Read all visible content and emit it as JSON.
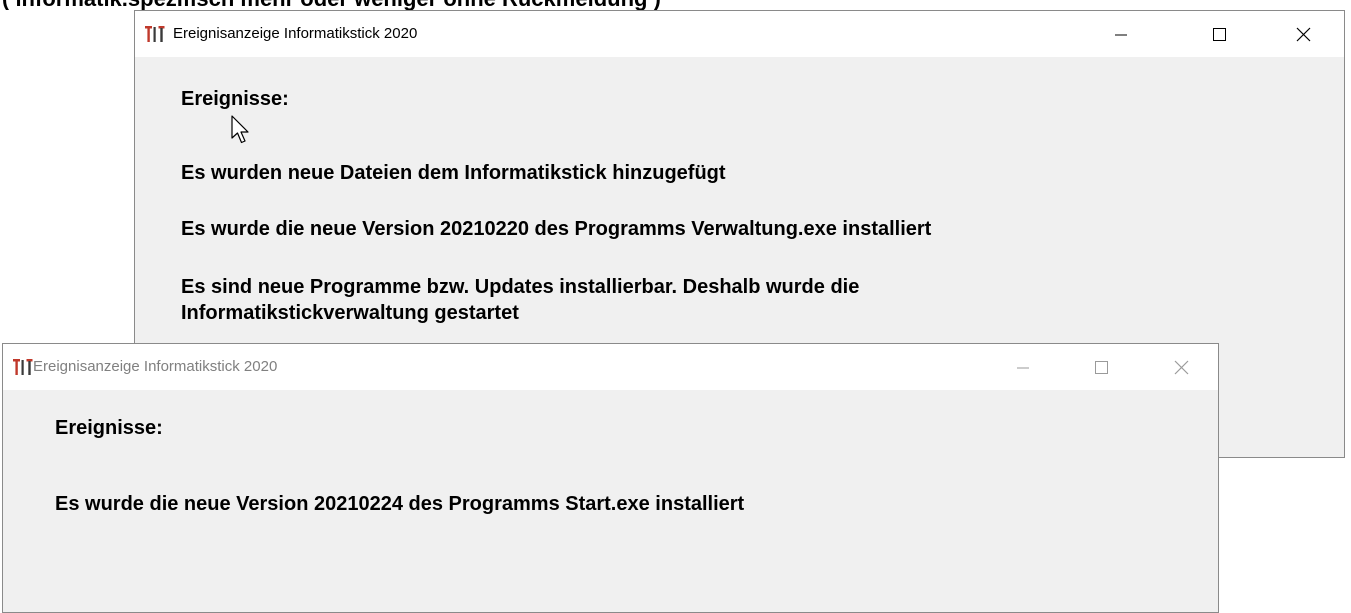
{
  "background_text_fragment": "( informatik.spezifisch mehr oder weniger ohne Rückmeldung )",
  "window_back": {
    "title": "Ereignisanzeige Informatikstick 2020",
    "heading": "Ereignisse:",
    "messages": [
      "Es wurden neue Dateien dem Informatikstick hinzugefügt",
      "Es wurde die neue Version 20210220 des Programms Verwaltung.exe installiert",
      "Es sind neue Programme bzw. Updates  installierbar. Deshalb wurde die",
      "Informatikstickverwaltung gestartet"
    ]
  },
  "window_front": {
    "title": "Ereignisanzeige Informatikstick 2020",
    "heading": "Ereignisse:",
    "messages": [
      "Es wurde die neue Version 20210224 des Programms Start.exe installiert"
    ]
  },
  "icons": {
    "app": "tools-icon",
    "minimize": "minimize-icon",
    "maximize": "maximize-icon",
    "close": "close-icon",
    "cursor": "mouse-pointer-icon"
  },
  "colors": {
    "window_bg": "#f0f0f0",
    "titlebar_bg": "#ffffff",
    "inactive_title": "#808080",
    "icon_red": "#c0392b",
    "icon_dark": "#3a3a3a"
  }
}
